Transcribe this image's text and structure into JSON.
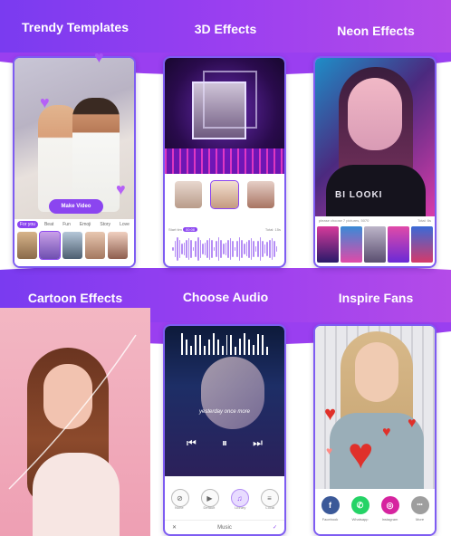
{
  "captions": [
    "Trendy Templates",
    "3D Effects",
    "Neon Effects",
    "Cartoon Effects",
    "Choose Audio",
    "Inspire Fans"
  ],
  "panel1": {
    "make_video": "Make Video",
    "tabs": [
      "For you",
      "Beat",
      "Fun",
      "Emoji",
      "Story",
      "Love"
    ]
  },
  "panel2": {
    "info_left": "Start tim",
    "info_pill": "00:08",
    "info_right": "Total: 15s"
  },
  "panel3": {
    "shirt_text": "BI LOOKI",
    "info_left": "please choose 7 pictures, 5070",
    "info_right": "Total: 6s"
  },
  "panel5": {
    "lyric": "yesterday once more",
    "buttons": [
      "None",
      "Default",
      "Library",
      "Local"
    ],
    "footer_title": "Music"
  },
  "panel6": {
    "socials": [
      {
        "label": "Facebook",
        "glyph": "f",
        "color": "#3b5998"
      },
      {
        "label": "Whatsapp",
        "glyph": "✆",
        "color": "#25d366"
      },
      {
        "label": "Instagram",
        "glyph": "◎",
        "color": "#d6249f"
      },
      {
        "label": "More",
        "glyph": "•••",
        "color": "#9e9e9e"
      }
    ]
  }
}
